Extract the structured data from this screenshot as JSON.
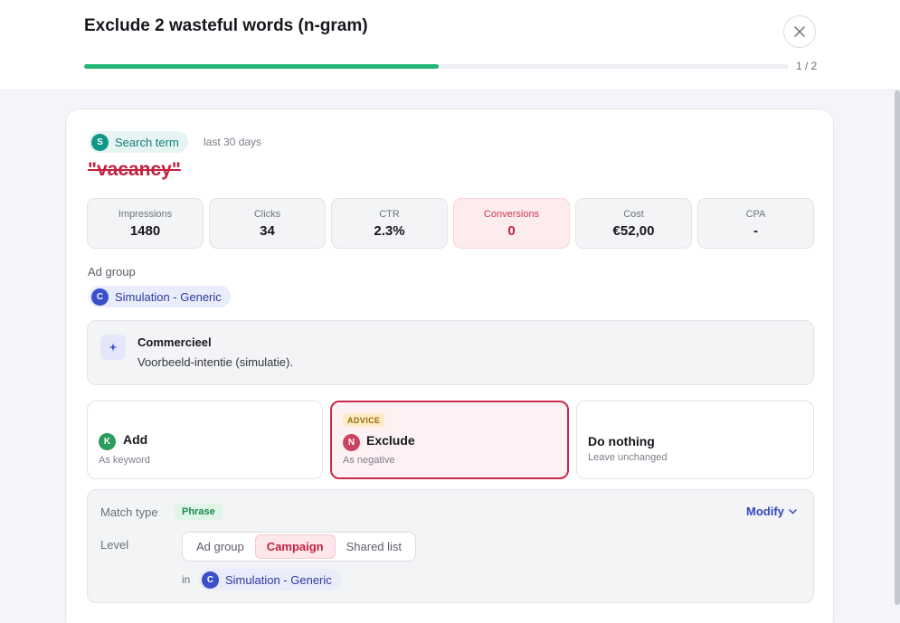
{
  "header": {
    "title": "Exclude 2 wasteful words (n-gram)",
    "progress_fraction": 0.503,
    "progress_label": "1 / 2"
  },
  "search_term": {
    "badge_letter": "S",
    "badge_label": "Search term",
    "range": "last 30 days",
    "term": "\"vacancy\""
  },
  "metrics": [
    {
      "label": "Impressions",
      "value": "1480"
    },
    {
      "label": "Clicks",
      "value": "34"
    },
    {
      "label": "CTR",
      "value": "2.3%"
    },
    {
      "label": "Conversions",
      "value": "0"
    },
    {
      "label": "Cost",
      "value": "€52,00"
    },
    {
      "label": "CPA",
      "value": "-"
    }
  ],
  "ad_group": {
    "label": "Ad group",
    "letter": "C",
    "name": "Simulation - Generic"
  },
  "intent": {
    "icon": "sparkle-icon",
    "title": "Commercieel",
    "description": "Voorbeeld-intentie (simulatie)."
  },
  "options": {
    "add": {
      "letter": "K",
      "title": "Add",
      "subtitle": "As keyword"
    },
    "exclude": {
      "badge": "ADVICE",
      "letter": "N",
      "title": "Exclude",
      "subtitle": "As negative"
    },
    "nothing": {
      "title": "Do nothing",
      "subtitle": "Leave unchanged"
    }
  },
  "settings": {
    "match_type_label": "Match type",
    "match_type_value": "Phrase",
    "modify_label": "Modify",
    "level_label": "Level",
    "levels": [
      "Ad group",
      "Campaign",
      "Shared list"
    ],
    "selected_level": "Campaign",
    "in_label": "in",
    "in_letter": "C",
    "in_name": "Simulation - Generic"
  },
  "colors": {
    "accent_green": "#22b573",
    "danger": "#c4213f",
    "indigo": "#3a4fc8",
    "teal": "#11968a"
  }
}
